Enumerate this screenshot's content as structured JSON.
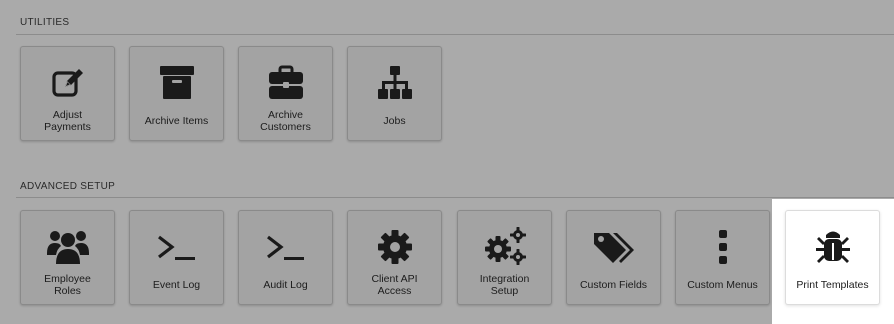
{
  "sections": [
    {
      "title": "UTILITIES",
      "tiles": [
        {
          "label": "Adjust\nPayments",
          "icon": "edit-icon"
        },
        {
          "label": "Archive Items",
          "icon": "archive-box-icon"
        },
        {
          "label": "Archive\nCustomers",
          "icon": "briefcase-icon"
        },
        {
          "label": "Jobs",
          "icon": "sitemap-icon"
        }
      ]
    },
    {
      "title": "ADVANCED SETUP",
      "tiles": [
        {
          "label": "Employee\nRoles",
          "icon": "users-icon"
        },
        {
          "label": "Event Log",
          "icon": "terminal-icon"
        },
        {
          "label": "Audit Log",
          "icon": "terminal-icon"
        },
        {
          "label": "Client API\nAccess",
          "icon": "gear-icon"
        },
        {
          "label": "Integration\nSetup",
          "icon": "gears-icon"
        },
        {
          "label": "Custom Fields",
          "icon": "tags-icon"
        },
        {
          "label": "Custom Menus",
          "icon": "vertical-ellipsis-icon"
        },
        {
          "label": "Print Templates",
          "icon": "bug-icon"
        }
      ]
    }
  ],
  "active_tile": "Print Templates",
  "colors": {
    "overlay": "#aaaaaa",
    "icon": "#1a1a1a",
    "highlight": "#ffffff"
  }
}
